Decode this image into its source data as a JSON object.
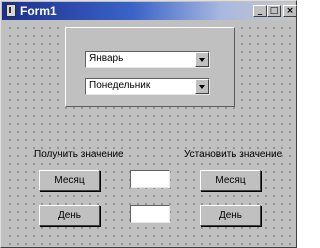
{
  "window": {
    "title": "Form1",
    "minimize_glyph": "_",
    "maximize_glyph": "□",
    "close_glyph": "×"
  },
  "panel": {
    "month_combo": {
      "value": "Январь"
    },
    "weekday_combo": {
      "value": "Понедельник"
    }
  },
  "labels": {
    "get_value": "Получить значение",
    "set_value": "Установить значение"
  },
  "buttons": {
    "get_month": "Месяц",
    "get_day": "День",
    "set_month": "Месяц",
    "set_day": "День"
  },
  "edits": {
    "month_value": "",
    "day_value": ""
  }
}
